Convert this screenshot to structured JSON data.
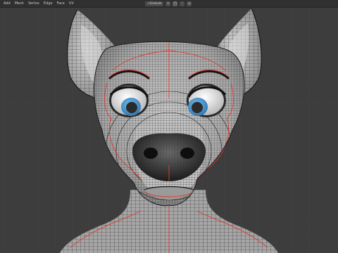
{
  "header": {
    "menu": [
      {
        "label": "Add",
        "name": "menu-add"
      },
      {
        "label": "Mesh",
        "name": "menu-mesh"
      },
      {
        "label": "Vertex",
        "name": "menu-vertex"
      },
      {
        "label": "Edge",
        "name": "menu-edge"
      },
      {
        "label": "Face",
        "name": "menu-face"
      },
      {
        "label": "UV",
        "name": "menu-uv"
      }
    ],
    "transform_orientation": "Global",
    "pivot_icon": "pivot-point-icon",
    "snap_icon": "snap-magnet-icon",
    "proportional_icon": "proportional-edit-icon"
  },
  "viewport": {
    "background": "#3d3d3d",
    "grid_color": "#474747",
    "mesh_fill": "#bcbcbc",
    "wire_color": "#1a1a1a",
    "seam_color": "#e23a2e",
    "iris_color": "#4f9fd6",
    "model": "stylized-fox-head-wireframe"
  }
}
